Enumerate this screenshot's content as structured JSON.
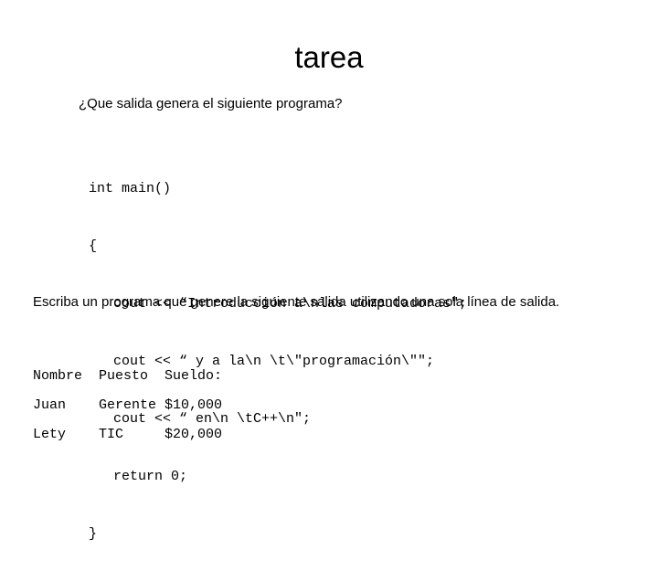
{
  "slide": {
    "title": "tarea",
    "question": "¿Que salida genera el siguiente programa?",
    "code_lines": [
      "int main()",
      "{",
      "   cout << “Introducción a\\nlas computadoras\";",
      "   cout << “ y a la\\n \\t\\\"programación\\\"\";",
      "   cout << “ en\\n \\tC++\\n\";",
      "   return 0;",
      "}"
    ],
    "instruction": "Escriba un programa que genere la siguiente salida utilizando una sola línea de salida.",
    "output_table": {
      "header": "Nombre  Puesto  Sueldo:",
      "rows": [
        "Juan    Gerente $10,000",
        "Lety    TIC     $20,000"
      ]
    }
  },
  "colors": {
    "background": "#ffffff",
    "text": "#000000"
  }
}
